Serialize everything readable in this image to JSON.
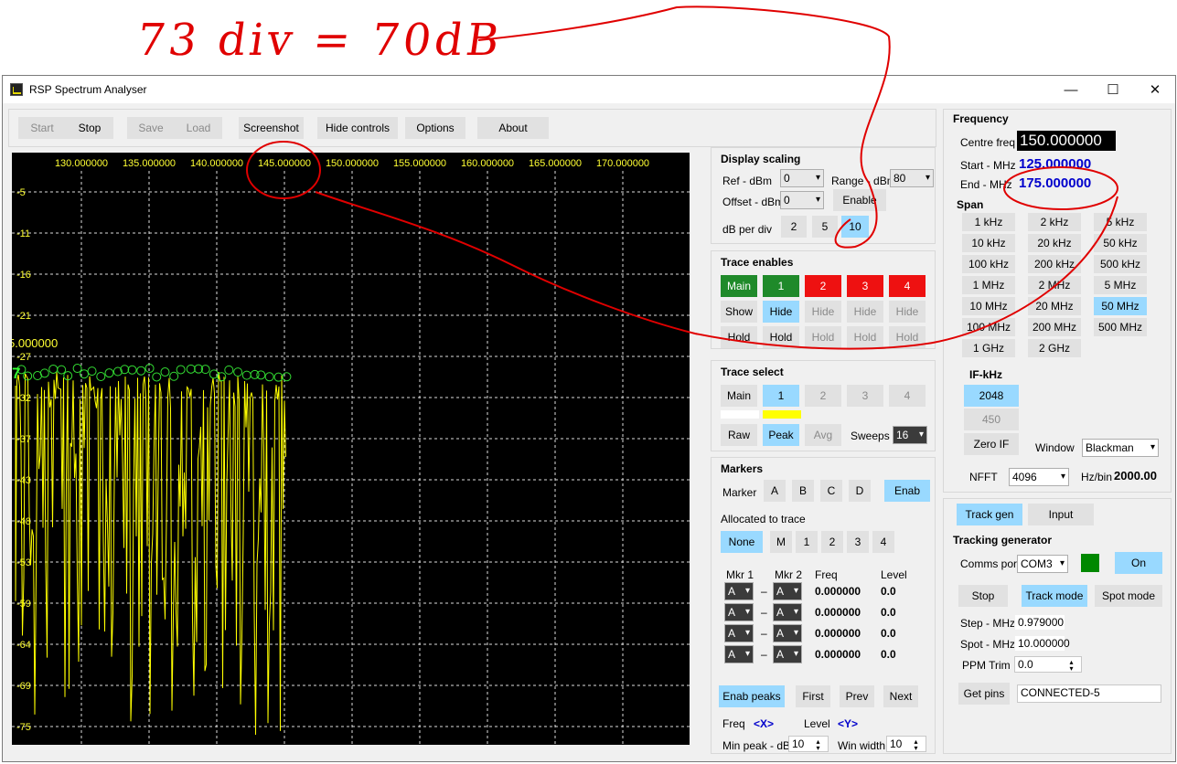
{
  "annotation": {
    "text": "73 div = 70dB"
  },
  "window": {
    "title": "RSP Spectrum Analyser"
  },
  "toolbar": {
    "start": "Start",
    "stop": "Stop",
    "save": "Save",
    "load": "Load",
    "screenshot": "Screenshot",
    "hide_controls": "Hide controls",
    "options": "Options",
    "about": "About"
  },
  "plot": {
    "freq_labels": [
      "130.000000",
      "135.000000",
      "140.000000",
      "145.000000",
      "150.000000",
      "155.000000",
      "160.000000",
      "165.000000",
      "170.000000"
    ],
    "level_labels": [
      "-5",
      "-11",
      "-16",
      "-21",
      "-27",
      "-32",
      "-37",
      "-43",
      "-48",
      "-53",
      "-59",
      "-64",
      "-69",
      "-75"
    ],
    "marker_freq": "5.000000",
    "marker_level": "7",
    "trace_color": "#ffff00",
    "peak_color": "#33dd33"
  },
  "display_scaling": {
    "title": "Display scaling",
    "ref_label": "Ref - dBm",
    "ref_value": "0",
    "range_label": "Range - dBm",
    "range_value": "80",
    "offset_label": "Offset - dBm",
    "offset_value": "0",
    "enable": "Enable",
    "db_per_div_label": "dB per div",
    "db_options": [
      "2",
      "5",
      "10"
    ],
    "db_selected": "10"
  },
  "trace_enables": {
    "title": "Trace enables",
    "traces": [
      "Main",
      "1",
      "2",
      "3",
      "4"
    ],
    "show_row": [
      "Show",
      "Hide",
      "Hide",
      "Hide",
      "Hide"
    ],
    "hold_row": [
      "Hold",
      "Hold",
      "Hold",
      "Hold",
      "Hold"
    ]
  },
  "trace_select": {
    "title": "Trace select",
    "traces": [
      "Main",
      "1",
      "2",
      "3",
      "4"
    ],
    "raw": "Raw",
    "peak": "Peak",
    "avg": "Avg",
    "sweeps_label": "Sweeps",
    "sweeps_value": "16"
  },
  "markers": {
    "title": "Markers",
    "marker_label": "Marker",
    "letters": [
      "A",
      "B",
      "C",
      "D"
    ],
    "enab": "Enab",
    "allocated_label": "Allocated to trace",
    "alloc_options": [
      "None",
      "M",
      "1",
      "2",
      "3",
      "4"
    ],
    "col_mkr1": "Mkr 1",
    "col_mkr2": "Mkr 2",
    "col_freq": "Freq",
    "col_level": "Level",
    "rows": [
      {
        "m1": "A",
        "m2": "A",
        "freq": "0.000000",
        "level": "0.0"
      },
      {
        "m1": "A",
        "m2": "A",
        "freq": "0.000000",
        "level": "0.0"
      },
      {
        "m1": "A",
        "m2": "A",
        "freq": "0.000000",
        "level": "0.0"
      },
      {
        "m1": "A",
        "m2": "A",
        "freq": "0.000000",
        "level": "0.0"
      }
    ],
    "dash": "–",
    "enab_peaks": "Enab peaks",
    "first": "First",
    "prev": "Prev",
    "next": "Next",
    "freq_label": "Freq",
    "freq_var": "<X>",
    "level_label": "Level",
    "level_var": "<Y>",
    "min_peak_label": "Min peak - dB",
    "min_peak_value": "10",
    "win_width_label": "Win width",
    "win_width_value": "10"
  },
  "frequency": {
    "title": "Frequency",
    "centre_label": "Centre freq",
    "centre_value": "150.000000",
    "start_label": "Start - MHz",
    "start_value": "125.000000",
    "end_label": "End - MHz",
    "end_value": "175.000000",
    "span_title": "Span",
    "spans": [
      "1 kHz",
      "2 kHz",
      "5 kHz",
      "10 kHz",
      "20 kHz",
      "50 kHz",
      "100 kHz",
      "200 kHz",
      "500 kHz",
      "1 MHz",
      "2 MHz",
      "5 MHz",
      "10 MHz",
      "20 MHz",
      "50 MHz",
      "100 MHz",
      "200 MHz",
      "500 MHz",
      "1 GHz",
      "2 GHz"
    ],
    "span_selected": "50 MHz",
    "if_title": "IF-kHz",
    "if_options": [
      "2048",
      "450"
    ],
    "zero_if": "Zero IF",
    "window_label": "Window",
    "window_value": "Blackman",
    "nfft_label": "NFFT",
    "nfft_value": "4096",
    "hzbin_label": "Hz/bin",
    "hzbin_value": "2000.00"
  },
  "tracking": {
    "tab_track": "Track gen",
    "tab_input": "Input",
    "title": "Tracking generator",
    "comms_label": "Comms port",
    "comms_value": "COM3",
    "status_color": "#008800",
    "on": "On",
    "stop": "Stop",
    "track_mode": "Track mode",
    "spot_mode": "Spot mode",
    "step_label": "Step - MHz",
    "step_value": "0.979000",
    "spot_label": "Spot - MHz",
    "spot_value": "10.000000",
    "ppm_label": "PPM Trim",
    "ppm_value": "0.0",
    "get_pins": "Get pins",
    "pins_value": "CONNECTED-5"
  }
}
